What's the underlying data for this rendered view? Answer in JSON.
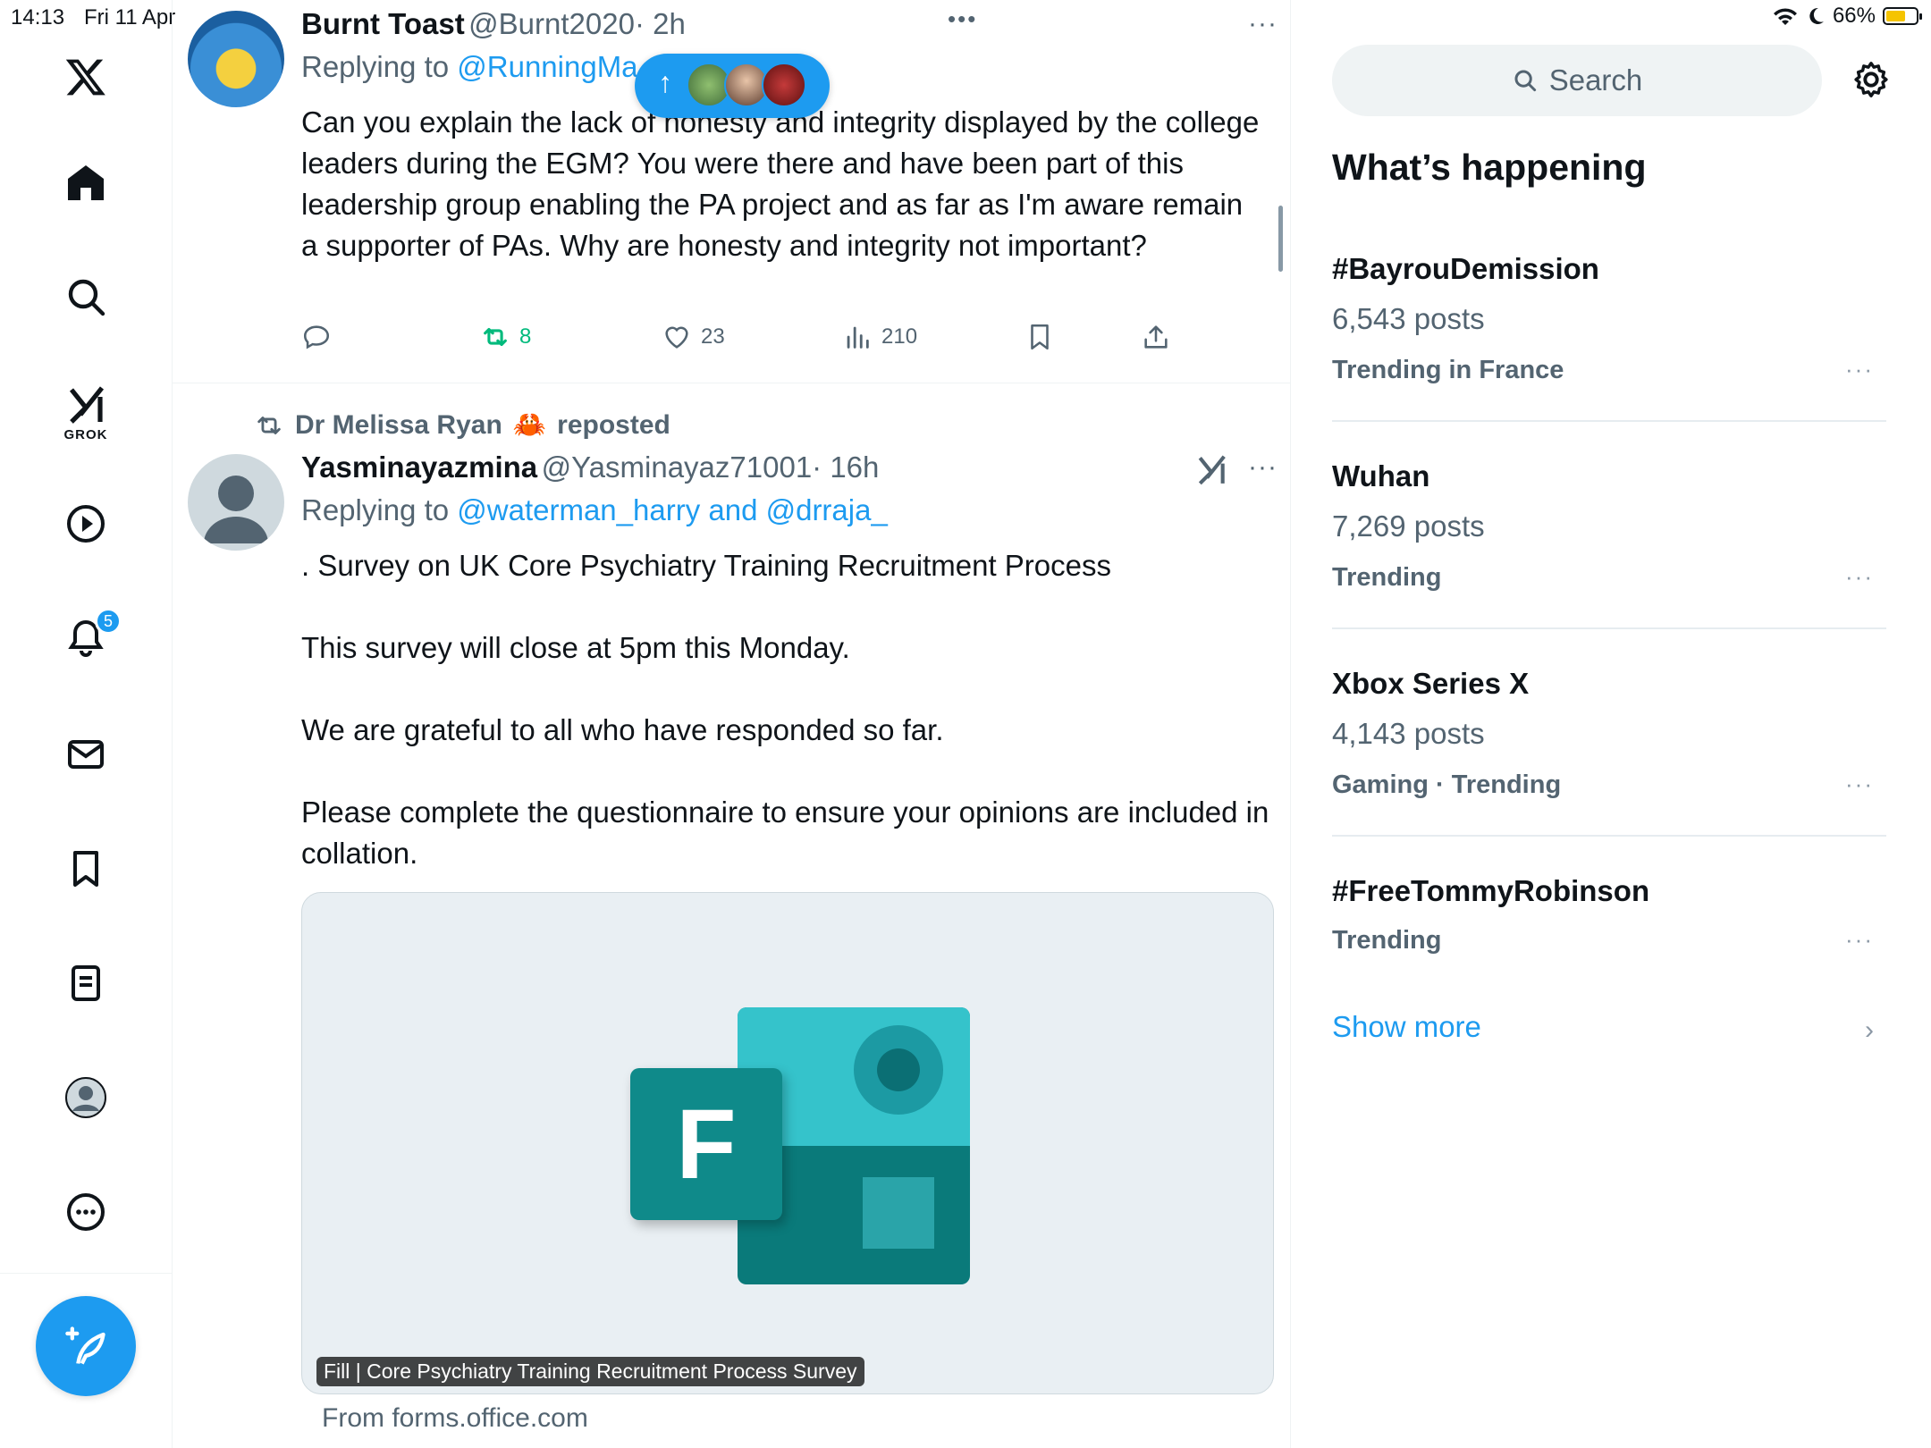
{
  "status_bar": {
    "time": "14:13",
    "date": "Fri 11 Apr",
    "battery": "66%",
    "battery_level": 0.66
  },
  "nav": {
    "grok_label": "GROK",
    "notifications_badge": "5"
  },
  "tweet1": {
    "name": "Burnt Toast",
    "handle": "@Burnt2020",
    "time": "· 2h",
    "replying_prefix": "Replying to ",
    "replying_to": "@RunningMa",
    "text": "Can you explain the lack of honesty and integrity displayed by the college leaders during the EGM? You were there and have been part of this leadership group enabling the PA project and as far as I'm aware remain a supporter of PAs. Why are honesty and integrity not important?",
    "retweets": "8",
    "likes": "23",
    "views": "210"
  },
  "tweet2": {
    "repost_user": "Dr Melissa Ryan",
    "repost_emoji": "🦀",
    "repost_label": "reposted",
    "name": "Yasminayazmina",
    "handle": "@Yasminayaz71001",
    "time": "· 16h",
    "replying_prefix": "Replying to ",
    "replying_to": "@waterman_harry and @drraja_",
    "text": ". Survey on UK Core Psychiatry Training Recruitment Process\n\nThis survey will close at 5pm this Monday.\n\nWe are grateful to all who have responded so far.\n\nPlease complete the questionnaire to ensure your opinions are included in collation.",
    "card_caption": "Fill | Core Psychiatry Training Recruitment Process Survey",
    "card_source": "From forms.office.com",
    "card_logo_letter": "F"
  },
  "sidebar": {
    "search_placeholder": "Search",
    "section_title": "What’s happening",
    "trends": [
      {
        "title": "#BayrouDemission",
        "posts": "6,543 posts",
        "meta": "Trending in France"
      },
      {
        "title": "Wuhan",
        "posts": "7,269 posts",
        "meta": "Trending"
      },
      {
        "title": "Xbox Series X",
        "posts": "4,143 posts",
        "meta": "Gaming · Trending"
      },
      {
        "title": "#FreeTommyRobinson",
        "posts": "",
        "meta": "Trending"
      }
    ],
    "show_more": "Show more"
  },
  "colors": {
    "accent": "#1d9bf0",
    "retweet_active": "#00ba7c",
    "muted": "#536471"
  }
}
